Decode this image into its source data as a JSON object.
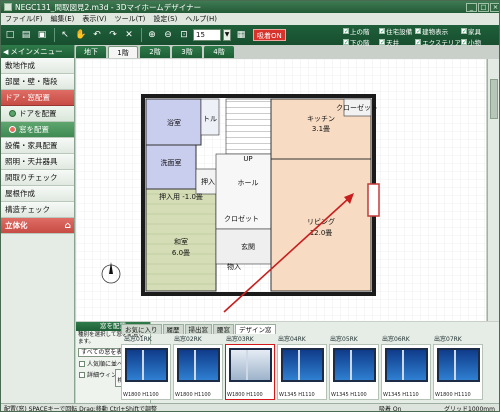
{
  "window": {
    "title": "NEGC131_間取図見2.m3d - 3Dマイホームデザイナー",
    "controls": [
      "_",
      "□",
      "×"
    ]
  },
  "menubar": {
    "items": [
      "ファイル(F)",
      "編集(E)",
      "表示(V)",
      "ツール(T)",
      "設定(S)",
      "ヘルプ(H)"
    ]
  },
  "toolbar": {
    "zoom_value": "15",
    "snap_label": "吸着ON",
    "checks": [
      {
        "label": "上の階",
        "checked": true
      },
      {
        "label": "住宅設備",
        "checked": true
      },
      {
        "label": "建物表示",
        "checked": true
      },
      {
        "label": "家具",
        "checked": true
      },
      {
        "label": "下の階",
        "checked": true
      },
      {
        "label": "天井",
        "checked": true
      },
      {
        "label": "エクステリア",
        "checked": true
      },
      {
        "label": "小物",
        "checked": true
      }
    ]
  },
  "sidebar": {
    "menu_header": "メインメニュー",
    "items": [
      {
        "label": "敷地作成",
        "type": "normal"
      },
      {
        "label": "部屋・壁・階段",
        "type": "normal"
      },
      {
        "label": "ドア・窓配置",
        "type": "header"
      },
      {
        "label": "ドアを配置",
        "type": "sub"
      },
      {
        "label": "窓を配置",
        "type": "sub-active"
      },
      {
        "label": "設備・家具配置",
        "type": "normal"
      },
      {
        "label": "照明・天井器具",
        "type": "normal"
      },
      {
        "label": "間取りチェック",
        "type": "normal"
      },
      {
        "label": "屋根作成",
        "type": "normal"
      },
      {
        "label": "構造チェック",
        "type": "normal"
      },
      {
        "label": "立体化",
        "type": "d3"
      }
    ]
  },
  "floor_tabs": {
    "items": [
      "地下",
      "1階",
      "2階",
      "3階",
      "4階"
    ],
    "active": "1階"
  },
  "plan": {
    "rooms": [
      "浴室",
      "トル",
      "洗面室",
      "UP",
      "和室",
      "6.0畳",
      "押入",
      "ホール",
      "玄関",
      "クロゼット",
      "キッチン",
      "3.1畳",
      "リビング",
      "12.0畳",
      "クローゼット",
      "物入"
    ],
    "closet_upper": "押入用 -1.0畳"
  },
  "window_panel": {
    "title": "窓を配置",
    "note": "種別を選択して窓を配置します。",
    "filter_value": "すべての窓を表示",
    "option_1": "人気順に並べる",
    "option_2": "詳細ウィンドウ",
    "search_label": "検索",
    "info_label": "詳細"
  },
  "catalog_tabs": {
    "items": [
      "お気に入り",
      "履歴",
      "掃出窓",
      "腰窓",
      "デザイン窓"
    ],
    "active": "デザイン窓"
  },
  "catalog": {
    "category_labels": [
      "出窓01RK",
      "出窓02RK",
      "出窓03RK",
      "出窓04RK",
      "出窓05RK",
      "出窓06RK",
      "出窓07RK",
      "出窓08RK"
    ],
    "items": [
      {
        "label": "W1800 H1100",
        "selected": false
      },
      {
        "label": "W1800 H1100",
        "selected": false
      },
      {
        "label": "W1800 H1100",
        "selected": true
      },
      {
        "label": "W1345 H1110",
        "selected": false
      },
      {
        "label": "W1345 H1100",
        "selected": false
      },
      {
        "label": "W1345 H1110",
        "selected": false
      },
      {
        "label": "W1800 H1110",
        "selected": false
      }
    ]
  },
  "statusbar": {
    "left": "配置(窓) SPACEキーで回転 Drag:移動 Ctrl+Shiftで調整",
    "middle": "吸着 On",
    "right": "グリッド1000mm"
  }
}
